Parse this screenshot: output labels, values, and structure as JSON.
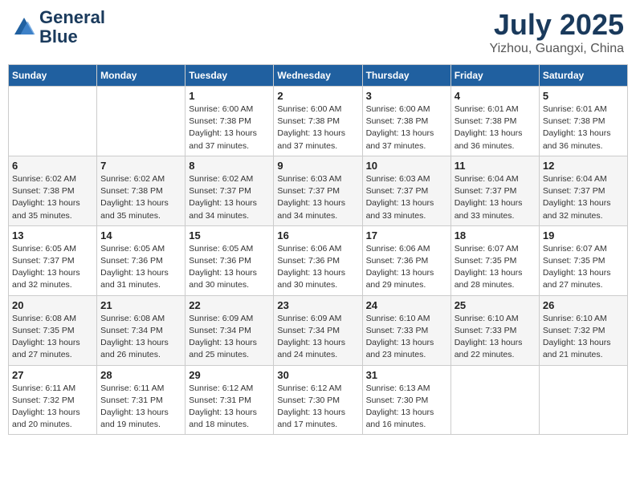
{
  "header": {
    "logo_line1": "General",
    "logo_line2": "Blue",
    "month": "July 2025",
    "location": "Yizhou, Guangxi, China"
  },
  "weekdays": [
    "Sunday",
    "Monday",
    "Tuesday",
    "Wednesday",
    "Thursday",
    "Friday",
    "Saturday"
  ],
  "weeks": [
    [
      {
        "day": "",
        "info": ""
      },
      {
        "day": "",
        "info": ""
      },
      {
        "day": "1",
        "info": "Sunrise: 6:00 AM\nSunset: 7:38 PM\nDaylight: 13 hours and 37 minutes."
      },
      {
        "day": "2",
        "info": "Sunrise: 6:00 AM\nSunset: 7:38 PM\nDaylight: 13 hours and 37 minutes."
      },
      {
        "day": "3",
        "info": "Sunrise: 6:00 AM\nSunset: 7:38 PM\nDaylight: 13 hours and 37 minutes."
      },
      {
        "day": "4",
        "info": "Sunrise: 6:01 AM\nSunset: 7:38 PM\nDaylight: 13 hours and 36 minutes."
      },
      {
        "day": "5",
        "info": "Sunrise: 6:01 AM\nSunset: 7:38 PM\nDaylight: 13 hours and 36 minutes."
      }
    ],
    [
      {
        "day": "6",
        "info": "Sunrise: 6:02 AM\nSunset: 7:38 PM\nDaylight: 13 hours and 35 minutes."
      },
      {
        "day": "7",
        "info": "Sunrise: 6:02 AM\nSunset: 7:38 PM\nDaylight: 13 hours and 35 minutes."
      },
      {
        "day": "8",
        "info": "Sunrise: 6:02 AM\nSunset: 7:37 PM\nDaylight: 13 hours and 34 minutes."
      },
      {
        "day": "9",
        "info": "Sunrise: 6:03 AM\nSunset: 7:37 PM\nDaylight: 13 hours and 34 minutes."
      },
      {
        "day": "10",
        "info": "Sunrise: 6:03 AM\nSunset: 7:37 PM\nDaylight: 13 hours and 33 minutes."
      },
      {
        "day": "11",
        "info": "Sunrise: 6:04 AM\nSunset: 7:37 PM\nDaylight: 13 hours and 33 minutes."
      },
      {
        "day": "12",
        "info": "Sunrise: 6:04 AM\nSunset: 7:37 PM\nDaylight: 13 hours and 32 minutes."
      }
    ],
    [
      {
        "day": "13",
        "info": "Sunrise: 6:05 AM\nSunset: 7:37 PM\nDaylight: 13 hours and 32 minutes."
      },
      {
        "day": "14",
        "info": "Sunrise: 6:05 AM\nSunset: 7:36 PM\nDaylight: 13 hours and 31 minutes."
      },
      {
        "day": "15",
        "info": "Sunrise: 6:05 AM\nSunset: 7:36 PM\nDaylight: 13 hours and 30 minutes."
      },
      {
        "day": "16",
        "info": "Sunrise: 6:06 AM\nSunset: 7:36 PM\nDaylight: 13 hours and 30 minutes."
      },
      {
        "day": "17",
        "info": "Sunrise: 6:06 AM\nSunset: 7:36 PM\nDaylight: 13 hours and 29 minutes."
      },
      {
        "day": "18",
        "info": "Sunrise: 6:07 AM\nSunset: 7:35 PM\nDaylight: 13 hours and 28 minutes."
      },
      {
        "day": "19",
        "info": "Sunrise: 6:07 AM\nSunset: 7:35 PM\nDaylight: 13 hours and 27 minutes."
      }
    ],
    [
      {
        "day": "20",
        "info": "Sunrise: 6:08 AM\nSunset: 7:35 PM\nDaylight: 13 hours and 27 minutes."
      },
      {
        "day": "21",
        "info": "Sunrise: 6:08 AM\nSunset: 7:34 PM\nDaylight: 13 hours and 26 minutes."
      },
      {
        "day": "22",
        "info": "Sunrise: 6:09 AM\nSunset: 7:34 PM\nDaylight: 13 hours and 25 minutes."
      },
      {
        "day": "23",
        "info": "Sunrise: 6:09 AM\nSunset: 7:34 PM\nDaylight: 13 hours and 24 minutes."
      },
      {
        "day": "24",
        "info": "Sunrise: 6:10 AM\nSunset: 7:33 PM\nDaylight: 13 hours and 23 minutes."
      },
      {
        "day": "25",
        "info": "Sunrise: 6:10 AM\nSunset: 7:33 PM\nDaylight: 13 hours and 22 minutes."
      },
      {
        "day": "26",
        "info": "Sunrise: 6:10 AM\nSunset: 7:32 PM\nDaylight: 13 hours and 21 minutes."
      }
    ],
    [
      {
        "day": "27",
        "info": "Sunrise: 6:11 AM\nSunset: 7:32 PM\nDaylight: 13 hours and 20 minutes."
      },
      {
        "day": "28",
        "info": "Sunrise: 6:11 AM\nSunset: 7:31 PM\nDaylight: 13 hours and 19 minutes."
      },
      {
        "day": "29",
        "info": "Sunrise: 6:12 AM\nSunset: 7:31 PM\nDaylight: 13 hours and 18 minutes."
      },
      {
        "day": "30",
        "info": "Sunrise: 6:12 AM\nSunset: 7:30 PM\nDaylight: 13 hours and 17 minutes."
      },
      {
        "day": "31",
        "info": "Sunrise: 6:13 AM\nSunset: 7:30 PM\nDaylight: 13 hours and 16 minutes."
      },
      {
        "day": "",
        "info": ""
      },
      {
        "day": "",
        "info": ""
      }
    ]
  ]
}
